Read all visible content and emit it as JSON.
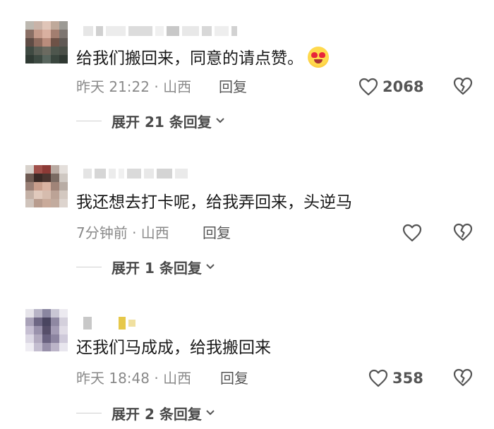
{
  "comments": [
    {
      "text": "给我们搬回来，同意的请点赞。",
      "has_emoji": true,
      "emoji": "heart-eyes-emoji",
      "meta": "昨天 21:22 · 山西",
      "reply_label": "回复",
      "likes": "2068",
      "expand_label": "展开 21 条回复"
    },
    {
      "text": "我还想去打卡呢，给我弄回来，头逆马",
      "meta": "7分钟前 · 山西",
      "reply_label": "回复",
      "likes": "",
      "expand_label": "展开 1 条回复"
    },
    {
      "text": "还我们马成成，给我搬回来",
      "meta": "昨天 18:48 · 山西",
      "reply_label": "回复",
      "likes": "358",
      "expand_label": "展开 2 条回复"
    }
  ],
  "icons": {
    "like": "heart-outline-icon",
    "dislike": "broken-heart-icon",
    "expand": "chevron-down-icon"
  },
  "colors": {
    "text": "#1a1a1a",
    "meta": "#8a8a8a",
    "icon": "#555555"
  }
}
